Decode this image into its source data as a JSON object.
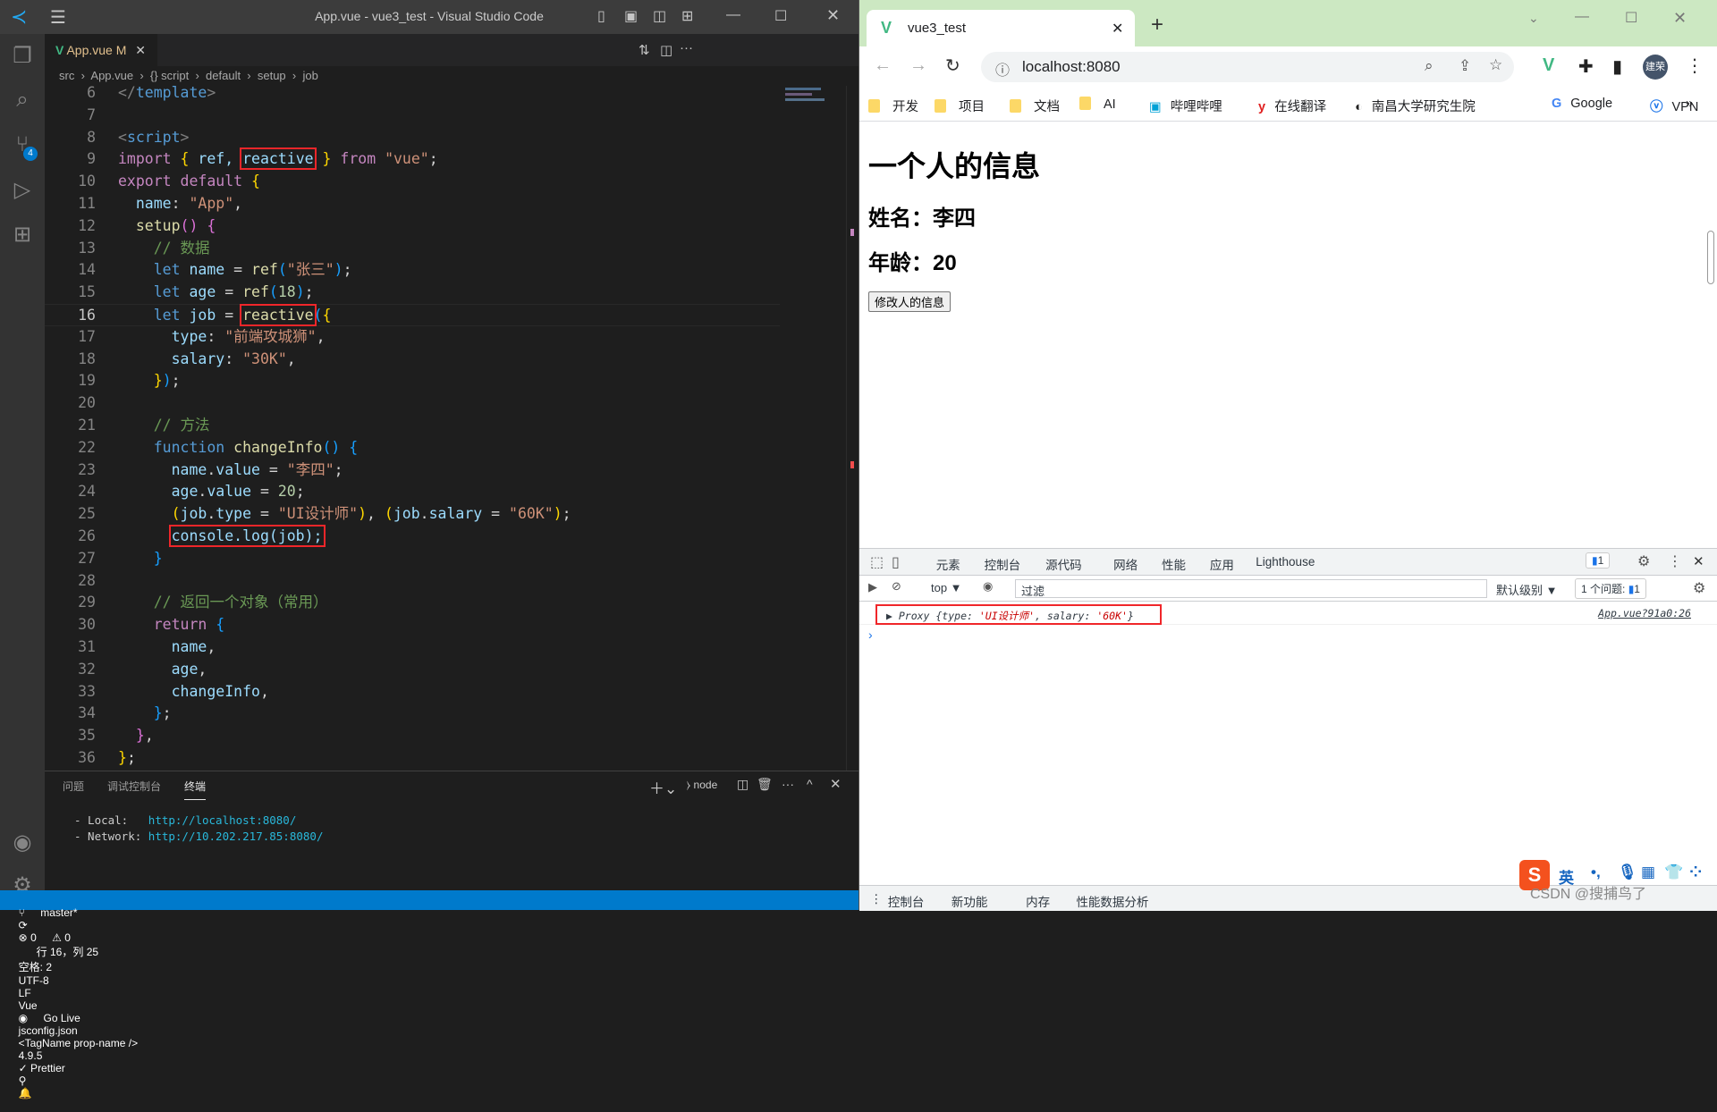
{
  "vscode": {
    "title": "App.vue - vue3_test - Visual Studio Code",
    "tab": {
      "label": "App.vue",
      "modified": "M"
    },
    "breadcrumb": [
      "src",
      "App.vue",
      "{} script",
      "default",
      "setup",
      "job"
    ],
    "lines": [
      {
        "n": "6",
        "t": [
          [
            "</",
            "tag"
          ],
          [
            "template",
            "tagn"
          ],
          [
            ">",
            "tag"
          ]
        ]
      },
      {
        "n": "7",
        "t": []
      },
      {
        "n": "8",
        "t": [
          [
            "<",
            "tag"
          ],
          [
            "script",
            "tagn"
          ],
          [
            ">",
            "tag"
          ]
        ]
      },
      {
        "n": "9",
        "t": [
          [
            "import",
            "kw"
          ],
          [
            " ",
            "pl"
          ],
          [
            "{",
            "b1"
          ],
          [
            " ref, ",
            "va"
          ],
          [
            "reactive",
            "va",
            "box"
          ],
          [
            " ",
            "pl"
          ],
          [
            "}",
            "b1"
          ],
          [
            " from ",
            "kw"
          ],
          [
            "\"vue\"",
            "str"
          ],
          [
            ";",
            "pl"
          ]
        ]
      },
      {
        "n": "10",
        "t": [
          [
            "export default ",
            "kw"
          ],
          [
            "{",
            "b1"
          ]
        ]
      },
      {
        "n": "11",
        "t": [
          [
            "  name",
            "va"
          ],
          [
            ": ",
            "pl"
          ],
          [
            "\"App\"",
            "str"
          ],
          [
            ",",
            "pl"
          ]
        ]
      },
      {
        "n": "12",
        "t": [
          [
            "  setup",
            "fn"
          ],
          [
            "()",
            "b2"
          ],
          [
            " ",
            "pl"
          ],
          [
            "{",
            "b2"
          ]
        ]
      },
      {
        "n": "13",
        "t": [
          [
            "    // 数据",
            "cm"
          ]
        ]
      },
      {
        "n": "14",
        "t": [
          [
            "    let ",
            "st"
          ],
          [
            "name",
            "va"
          ],
          [
            " = ",
            "pl"
          ],
          [
            "ref",
            "fn"
          ],
          [
            "(",
            "b3"
          ],
          [
            "\"张三\"",
            "str"
          ],
          [
            ")",
            "b3"
          ],
          [
            ";",
            "pl"
          ]
        ]
      },
      {
        "n": "15",
        "t": [
          [
            "    let ",
            "st"
          ],
          [
            "age",
            "va"
          ],
          [
            " = ",
            "pl"
          ],
          [
            "ref",
            "fn"
          ],
          [
            "(",
            "b3"
          ],
          [
            "18",
            "nu"
          ],
          [
            ")",
            "b3"
          ],
          [
            ";",
            "pl"
          ]
        ]
      },
      {
        "n": "16",
        "cur": true,
        "t": [
          [
            "    let ",
            "st"
          ],
          [
            "job",
            "va"
          ],
          [
            " = ",
            "pl"
          ],
          [
            "reactive",
            "fn",
            "box"
          ],
          [
            "(",
            "b3"
          ],
          [
            "{",
            "b1"
          ]
        ]
      },
      {
        "n": "17",
        "t": [
          [
            "      type",
            "va"
          ],
          [
            ": ",
            "pl"
          ],
          [
            "\"前端攻城狮\"",
            "str"
          ],
          [
            ",",
            "pl"
          ]
        ]
      },
      {
        "n": "18",
        "t": [
          [
            "      salary",
            "va"
          ],
          [
            ": ",
            "pl"
          ],
          [
            "\"30K\"",
            "str"
          ],
          [
            ",",
            "pl"
          ]
        ]
      },
      {
        "n": "19",
        "t": [
          [
            "    ",
            "pl"
          ],
          [
            "}",
            "b1"
          ],
          [
            ")",
            "b3"
          ],
          [
            ";",
            "pl"
          ]
        ]
      },
      {
        "n": "20",
        "t": []
      },
      {
        "n": "21",
        "t": [
          [
            "    // 方法",
            "cm"
          ]
        ]
      },
      {
        "n": "22",
        "t": [
          [
            "    function ",
            "st"
          ],
          [
            "changeInfo",
            "fn"
          ],
          [
            "()",
            "b3"
          ],
          [
            " ",
            "pl"
          ],
          [
            "{",
            "b3"
          ]
        ]
      },
      {
        "n": "23",
        "t": [
          [
            "      name",
            "va"
          ],
          [
            ".",
            "pl"
          ],
          [
            "value",
            "va"
          ],
          [
            " = ",
            "pl"
          ],
          [
            "\"李四\"",
            "str"
          ],
          [
            ";",
            "pl"
          ]
        ]
      },
      {
        "n": "24",
        "t": [
          [
            "      age",
            "va"
          ],
          [
            ".",
            "pl"
          ],
          [
            "value",
            "va"
          ],
          [
            " = ",
            "pl"
          ],
          [
            "20",
            "nu"
          ],
          [
            ";",
            "pl"
          ]
        ]
      },
      {
        "n": "25",
        "t": [
          [
            "      ",
            "pl"
          ],
          [
            "(",
            "b1"
          ],
          [
            "job",
            "va"
          ],
          [
            ".",
            "pl"
          ],
          [
            "type",
            "va"
          ],
          [
            " = ",
            "pl"
          ],
          [
            "\"UI设计师\"",
            "str"
          ],
          [
            ")",
            "b1"
          ],
          [
            ", ",
            "pl"
          ],
          [
            "(",
            "b1"
          ],
          [
            "job",
            "va"
          ],
          [
            ".",
            "pl"
          ],
          [
            "salary",
            "va"
          ],
          [
            " = ",
            "pl"
          ],
          [
            "\"60K\"",
            "str"
          ],
          [
            ")",
            "b1"
          ],
          [
            ";",
            "pl"
          ]
        ]
      },
      {
        "n": "26",
        "t": [
          [
            "      ",
            "pl"
          ],
          [
            "console.log(job);",
            "va",
            "box"
          ]
        ]
      },
      {
        "n": "27",
        "t": [
          [
            "    }",
            "b3"
          ]
        ]
      },
      {
        "n": "28",
        "t": []
      },
      {
        "n": "29",
        "t": [
          [
            "    // 返回一个对象（常用）",
            "cm"
          ]
        ]
      },
      {
        "n": "30",
        "t": [
          [
            "    return ",
            "kw"
          ],
          [
            "{",
            "b3"
          ]
        ]
      },
      {
        "n": "31",
        "t": [
          [
            "      name",
            "va"
          ],
          [
            ",",
            "pl"
          ]
        ]
      },
      {
        "n": "32",
        "t": [
          [
            "      age",
            "va"
          ],
          [
            ",",
            "pl"
          ]
        ]
      },
      {
        "n": "33",
        "t": [
          [
            "      changeInfo",
            "va"
          ],
          [
            ",",
            "pl"
          ]
        ]
      },
      {
        "n": "34",
        "t": [
          [
            "    }",
            "b3"
          ],
          [
            ";",
            "pl"
          ]
        ]
      },
      {
        "n": "35",
        "t": [
          [
            "  }",
            "b2"
          ],
          [
            ",",
            "pl"
          ]
        ]
      },
      {
        "n": "36",
        "t": [
          [
            "}",
            "b1"
          ],
          [
            ";",
            "pl"
          ]
        ]
      }
    ],
    "panel": {
      "tabs": [
        "问题",
        "调试控制台",
        "终端"
      ],
      "active": 2,
      "shell": "node",
      "terminal": [
        {
          "label": "- Local:   ",
          "url": "http://localhost:8080/"
        },
        {
          "label": "- Network: ",
          "url": "http://10.202.217.85:8080/"
        }
      ]
    },
    "status": {
      "branch": "master*",
      "errors": "0",
      "warnings": "0",
      "position": "行 16，列 25",
      "spaces": "空格: 2",
      "encoding": "UTF-8",
      "eol": "LF",
      "language": "Vue",
      "golive": "Go Live",
      "jsconfig": "jsconfig.json",
      "tagname": "<TagName prop-name />",
      "version": "4.9.5",
      "prettier": "✓ Prettier",
      "source_control_badge": "4"
    }
  },
  "browser": {
    "tab_title": "vue3_test",
    "url": "localhost:8080",
    "avatar": "建荣",
    "bookmarks": [
      "开发",
      "项目",
      "文档",
      "AI",
      "哔哩哔哩",
      "在线翻译",
      "南昌大学研究生院",
      "Google",
      "VPN"
    ],
    "page": {
      "h1": "一个人的信息",
      "name_line": "姓名：李四",
      "age_line": "年龄：20",
      "button": "修改人的信息"
    },
    "devtools": {
      "tabs": [
        "元素",
        "控制台",
        "源代码",
        "网络",
        "性能",
        "应用",
        "Lighthouse"
      ],
      "active": 1,
      "issues_badge": "1",
      "context": "top ▼",
      "filter_placeholder": "过滤",
      "level": "默认级别 ▼",
      "issues": "1 个问题:",
      "issues_count": "1",
      "log": {
        "prefix": "▶ Proxy {type: ",
        "type": "'UI设计师'",
        "mid": ", salary: ",
        "salary": "'60K'",
        "suffix": "}",
        "source": "App.vue?91a0:26"
      },
      "prompt": "›",
      "drawer": [
        "控制台",
        "新功能",
        "内存",
        "性能数据分析"
      ]
    },
    "ime": {
      "lang": "英",
      "watermark": "CSDN @搜捕鸟了"
    }
  },
  "colors": {
    "statusbar": "#007acc",
    "tabstrip": "#cce8c2",
    "highlight_box": "#f0262a",
    "devtools_active": "#1a73e8"
  }
}
